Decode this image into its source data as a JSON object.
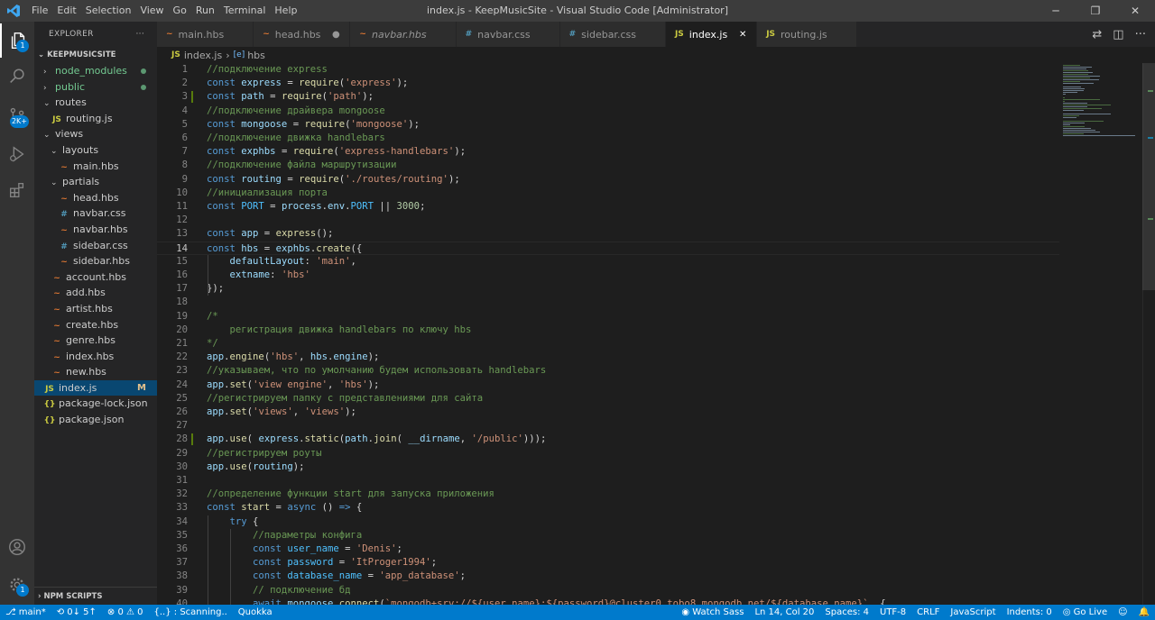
{
  "app": {
    "title": "index.js - KeepMusicSite - Visual Studio Code [Administrator]",
    "menu": [
      "File",
      "Edit",
      "Selection",
      "View",
      "Go",
      "Run",
      "Terminal",
      "Help"
    ],
    "window_controls": [
      "─",
      "❐",
      "✕"
    ]
  },
  "activity_bar": {
    "explorer_badge": "1",
    "scm_badge": "2K+"
  },
  "explorer": {
    "title": "EXPLORER",
    "more": "···",
    "section": "KEEPMUSICSITE",
    "tree": [
      {
        "label": "node_modules",
        "kind": "folder",
        "depth": 0,
        "open": false,
        "color": "#73c991",
        "dot": true
      },
      {
        "label": "public",
        "kind": "folder",
        "depth": 0,
        "open": false,
        "color": "#73c991",
        "dot": true
      },
      {
        "label": "routes",
        "kind": "folder",
        "depth": 0,
        "open": true
      },
      {
        "label": "routing.js",
        "kind": "js",
        "depth": 1
      },
      {
        "label": "views",
        "kind": "folder",
        "depth": 0,
        "open": true
      },
      {
        "label": "layouts",
        "kind": "folder",
        "depth": 1,
        "open": true
      },
      {
        "label": "main.hbs",
        "kind": "hbs",
        "depth": 2
      },
      {
        "label": "partials",
        "kind": "folder",
        "depth": 1,
        "open": true
      },
      {
        "label": "head.hbs",
        "kind": "hbs",
        "depth": 2
      },
      {
        "label": "navbar.css",
        "kind": "css",
        "depth": 2
      },
      {
        "label": "navbar.hbs",
        "kind": "hbs",
        "depth": 2
      },
      {
        "label": "sidebar.css",
        "kind": "css",
        "depth": 2
      },
      {
        "label": "sidebar.hbs",
        "kind": "hbs",
        "depth": 2
      },
      {
        "label": "account.hbs",
        "kind": "hbs",
        "depth": 1
      },
      {
        "label": "add.hbs",
        "kind": "hbs",
        "depth": 1
      },
      {
        "label": "artist.hbs",
        "kind": "hbs",
        "depth": 1
      },
      {
        "label": "create.hbs",
        "kind": "hbs",
        "depth": 1
      },
      {
        "label": "genre.hbs",
        "kind": "hbs",
        "depth": 1
      },
      {
        "label": "index.hbs",
        "kind": "hbs",
        "depth": 1
      },
      {
        "label": "new.hbs",
        "kind": "hbs",
        "depth": 1
      },
      {
        "label": "index.js",
        "kind": "js",
        "depth": 0,
        "selected": true,
        "status": "M"
      },
      {
        "label": "package-lock.json",
        "kind": "json",
        "depth": 0
      },
      {
        "label": "package.json",
        "kind": "json",
        "depth": 0
      }
    ],
    "npm_scripts": "NPM SCRIPTS"
  },
  "tabs": [
    {
      "label": "main.hbs",
      "kind": "hbs",
      "italic": false
    },
    {
      "label": "head.hbs",
      "kind": "hbs",
      "italic": false,
      "dirty": true
    },
    {
      "label": "navbar.hbs",
      "kind": "hbs",
      "italic": true
    },
    {
      "label": "navbar.css",
      "kind": "css",
      "italic": false
    },
    {
      "label": "sidebar.css",
      "kind": "css",
      "italic": false
    },
    {
      "label": "index.js",
      "kind": "js",
      "italic": false,
      "active": true
    },
    {
      "label": "routing.js",
      "kind": "js",
      "italic": false
    }
  ],
  "tab_icons": {
    "js": "JS",
    "hbs": "~",
    "css": "#",
    "json": "{}"
  },
  "breadcrumb": {
    "file": "index.js",
    "symbol": "hbs",
    "file_icon": "JS",
    "symbol_icon": "[e]"
  },
  "editor": {
    "current_line": 14,
    "modified_lines": [
      3,
      28
    ],
    "lines": [
      [
        [
          "c",
          "//подключение express"
        ]
      ],
      [
        [
          "k",
          "const "
        ],
        [
          "v",
          "express"
        ],
        [
          "p",
          " = "
        ],
        [
          "f",
          "require"
        ],
        [
          "p",
          "("
        ],
        [
          "s",
          "'express'"
        ],
        [
          "p",
          ");"
        ]
      ],
      [
        [
          "k",
          "const "
        ],
        [
          "v",
          "path"
        ],
        [
          "p",
          " = "
        ],
        [
          "f",
          "require"
        ],
        [
          "p",
          "("
        ],
        [
          "s",
          "'path'"
        ],
        [
          "p",
          ");"
        ]
      ],
      [
        [
          "c",
          "//подключение драйвера mongoose"
        ]
      ],
      [
        [
          "k",
          "const "
        ],
        [
          "v",
          "mongoose"
        ],
        [
          "p",
          " = "
        ],
        [
          "f",
          "require"
        ],
        [
          "p",
          "("
        ],
        [
          "s",
          "'mongoose'"
        ],
        [
          "p",
          ");"
        ]
      ],
      [
        [
          "c",
          "//подключение движка handlebars"
        ]
      ],
      [
        [
          "k",
          "const "
        ],
        [
          "v",
          "exphbs"
        ],
        [
          "p",
          " = "
        ],
        [
          "f",
          "require"
        ],
        [
          "p",
          "("
        ],
        [
          "s",
          "'express-handlebars'"
        ],
        [
          "p",
          ");"
        ]
      ],
      [
        [
          "c",
          "//подключение файла маршрутизации"
        ]
      ],
      [
        [
          "k",
          "const "
        ],
        [
          "v",
          "routing"
        ],
        [
          "p",
          " = "
        ],
        [
          "f",
          "require"
        ],
        [
          "p",
          "("
        ],
        [
          "s",
          "'./routes/routing'"
        ],
        [
          "p",
          ");"
        ]
      ],
      [
        [
          "c",
          "//инициализация порта"
        ]
      ],
      [
        [
          "k",
          "const "
        ],
        [
          "cn",
          "PORT"
        ],
        [
          "p",
          " = "
        ],
        [
          "v",
          "process"
        ],
        [
          "p",
          "."
        ],
        [
          "v",
          "env"
        ],
        [
          "p",
          "."
        ],
        [
          "cn",
          "PORT"
        ],
        [
          "p",
          " || "
        ],
        [
          "n",
          "3000"
        ],
        [
          "p",
          ";"
        ]
      ],
      [],
      [
        [
          "k",
          "const "
        ],
        [
          "v",
          "app"
        ],
        [
          "p",
          " = "
        ],
        [
          "f",
          "express"
        ],
        [
          "p",
          "();"
        ]
      ],
      [
        [
          "k",
          "const "
        ],
        [
          "v",
          "hbs"
        ],
        [
          "p",
          " = "
        ],
        [
          "v",
          "exphbs"
        ],
        [
          "p",
          "."
        ],
        [
          "f",
          "create"
        ],
        [
          "p",
          "({"
        ]
      ],
      [
        [
          "p",
          "    "
        ],
        [
          "v",
          "defaultLayout"
        ],
        [
          "p",
          ": "
        ],
        [
          "s",
          "'main'"
        ],
        [
          "p",
          ","
        ]
      ],
      [
        [
          "p",
          "    "
        ],
        [
          "v",
          "extname"
        ],
        [
          "p",
          ": "
        ],
        [
          "s",
          "'hbs'"
        ]
      ],
      [
        [
          "p",
          "});"
        ]
      ],
      [],
      [
        [
          "c",
          "/*"
        ]
      ],
      [
        [
          "c",
          "    регистрация движка handlebars по ключу hbs"
        ]
      ],
      [
        [
          "c",
          "*/"
        ]
      ],
      [
        [
          "v",
          "app"
        ],
        [
          "p",
          "."
        ],
        [
          "f",
          "engine"
        ],
        [
          "p",
          "("
        ],
        [
          "s",
          "'hbs'"
        ],
        [
          "p",
          ", "
        ],
        [
          "v",
          "hbs"
        ],
        [
          "p",
          "."
        ],
        [
          "v",
          "engine"
        ],
        [
          "p",
          ");"
        ]
      ],
      [
        [
          "c",
          "//указываем, что по умолчанию будем использовать handlebars"
        ]
      ],
      [
        [
          "v",
          "app"
        ],
        [
          "p",
          "."
        ],
        [
          "f",
          "set"
        ],
        [
          "p",
          "("
        ],
        [
          "s",
          "'view engine'"
        ],
        [
          "p",
          ", "
        ],
        [
          "s",
          "'hbs'"
        ],
        [
          "p",
          ");"
        ]
      ],
      [
        [
          "c",
          "//регистрируем папку с представлениями для сайта"
        ]
      ],
      [
        [
          "v",
          "app"
        ],
        [
          "p",
          "."
        ],
        [
          "f",
          "set"
        ],
        [
          "p",
          "("
        ],
        [
          "s",
          "'views'"
        ],
        [
          "p",
          ", "
        ],
        [
          "s",
          "'views'"
        ],
        [
          "p",
          ");"
        ]
      ],
      [],
      [
        [
          "v",
          "app"
        ],
        [
          "p",
          "."
        ],
        [
          "f",
          "use"
        ],
        [
          "p",
          "( "
        ],
        [
          "v",
          "express"
        ],
        [
          "p",
          "."
        ],
        [
          "f",
          "static"
        ],
        [
          "p",
          "("
        ],
        [
          "v",
          "path"
        ],
        [
          "p",
          "."
        ],
        [
          "f",
          "join"
        ],
        [
          "p",
          "( "
        ],
        [
          "v",
          "__dirname"
        ],
        [
          "p",
          ", "
        ],
        [
          "s",
          "'/public'"
        ],
        [
          "p",
          ")));"
        ]
      ],
      [
        [
          "c",
          "//регистрируем роуты"
        ]
      ],
      [
        [
          "v",
          "app"
        ],
        [
          "p",
          "."
        ],
        [
          "f",
          "use"
        ],
        [
          "p",
          "("
        ],
        [
          "v",
          "routing"
        ],
        [
          "p",
          ");"
        ]
      ],
      [],
      [
        [
          "c",
          "//определение функции start для запуска приложения"
        ]
      ],
      [
        [
          "k",
          "const "
        ],
        [
          "f",
          "start"
        ],
        [
          "p",
          " = "
        ],
        [
          "k",
          "async"
        ],
        [
          "p",
          " () "
        ],
        [
          "k",
          "=>"
        ],
        [
          "p",
          " {"
        ]
      ],
      [
        [
          "p",
          "    "
        ],
        [
          "k",
          "try"
        ],
        [
          "p",
          " {"
        ]
      ],
      [
        [
          "p",
          "        "
        ],
        [
          "c",
          "//параметры конфига"
        ]
      ],
      [
        [
          "p",
          "        "
        ],
        [
          "k",
          "const "
        ],
        [
          "cn",
          "user_name"
        ],
        [
          "p",
          " = "
        ],
        [
          "s",
          "'Denis'"
        ],
        [
          "p",
          ";"
        ]
      ],
      [
        [
          "p",
          "        "
        ],
        [
          "k",
          "const "
        ],
        [
          "cn",
          "password"
        ],
        [
          "p",
          " = "
        ],
        [
          "s",
          "'ItProger1994'"
        ],
        [
          "p",
          ";"
        ]
      ],
      [
        [
          "p",
          "        "
        ],
        [
          "k",
          "const "
        ],
        [
          "cn",
          "database_name"
        ],
        [
          "p",
          " = "
        ],
        [
          "s",
          "'app_database'"
        ],
        [
          "p",
          ";"
        ]
      ],
      [
        [
          "p",
          "        "
        ],
        [
          "c",
          "// подключение бд"
        ]
      ],
      [
        [
          "p",
          "        "
        ],
        [
          "k",
          "await "
        ],
        [
          "v",
          "mongoose"
        ],
        [
          "p",
          "."
        ],
        [
          "f",
          "connect"
        ],
        [
          "p",
          "("
        ],
        [
          "s",
          "`mongodb+srv://${user_name}:${password}@cluster0.tobo8.mongodb.net/${database_name}`"
        ],
        [
          "p",
          ", {"
        ]
      ]
    ]
  },
  "statusbar": {
    "left": [
      "⎇ main*",
      "⟲ 0↓ 5↑",
      "⊗ 0 ⚠ 0",
      "{..} : Scanning..",
      "Quokka"
    ],
    "right": [
      "◉ Watch Sass",
      "Ln 14, Col 20",
      "Spaces: 4",
      "UTF-8",
      "CRLF",
      "JavaScript",
      "Indents: 0",
      "◎ Go Live",
      "☺",
      "🔔"
    ]
  }
}
